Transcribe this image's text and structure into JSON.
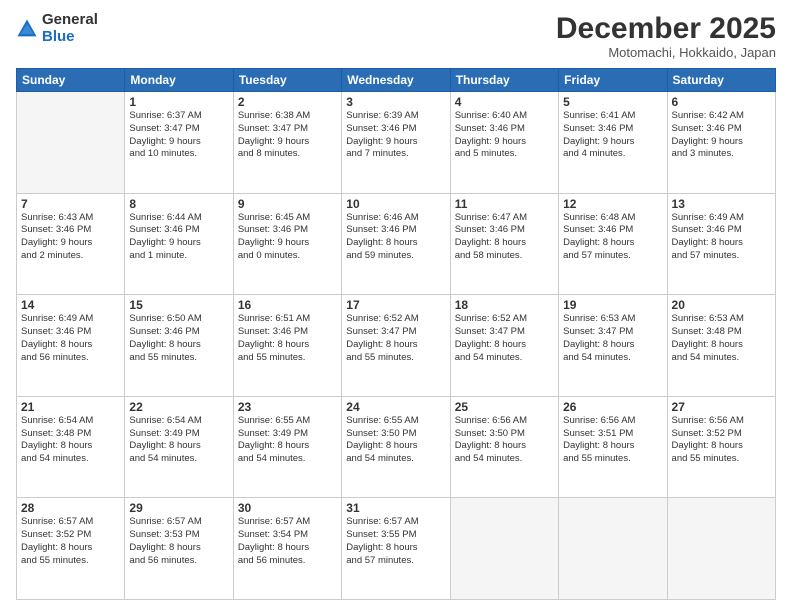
{
  "logo": {
    "general": "General",
    "blue": "Blue"
  },
  "title": "December 2025",
  "subtitle": "Motomachi, Hokkaido, Japan",
  "days_header": [
    "Sunday",
    "Monday",
    "Tuesday",
    "Wednesday",
    "Thursday",
    "Friday",
    "Saturday"
  ],
  "weeks": [
    [
      {
        "day": "",
        "info": ""
      },
      {
        "day": "1",
        "info": "Sunrise: 6:37 AM\nSunset: 3:47 PM\nDaylight: 9 hours\nand 10 minutes."
      },
      {
        "day": "2",
        "info": "Sunrise: 6:38 AM\nSunset: 3:47 PM\nDaylight: 9 hours\nand 8 minutes."
      },
      {
        "day": "3",
        "info": "Sunrise: 6:39 AM\nSunset: 3:46 PM\nDaylight: 9 hours\nand 7 minutes."
      },
      {
        "day": "4",
        "info": "Sunrise: 6:40 AM\nSunset: 3:46 PM\nDaylight: 9 hours\nand 5 minutes."
      },
      {
        "day": "5",
        "info": "Sunrise: 6:41 AM\nSunset: 3:46 PM\nDaylight: 9 hours\nand 4 minutes."
      },
      {
        "day": "6",
        "info": "Sunrise: 6:42 AM\nSunset: 3:46 PM\nDaylight: 9 hours\nand 3 minutes."
      }
    ],
    [
      {
        "day": "7",
        "info": "Sunrise: 6:43 AM\nSunset: 3:46 PM\nDaylight: 9 hours\nand 2 minutes."
      },
      {
        "day": "8",
        "info": "Sunrise: 6:44 AM\nSunset: 3:46 PM\nDaylight: 9 hours\nand 1 minute."
      },
      {
        "day": "9",
        "info": "Sunrise: 6:45 AM\nSunset: 3:46 PM\nDaylight: 9 hours\nand 0 minutes."
      },
      {
        "day": "10",
        "info": "Sunrise: 6:46 AM\nSunset: 3:46 PM\nDaylight: 8 hours\nand 59 minutes."
      },
      {
        "day": "11",
        "info": "Sunrise: 6:47 AM\nSunset: 3:46 PM\nDaylight: 8 hours\nand 58 minutes."
      },
      {
        "day": "12",
        "info": "Sunrise: 6:48 AM\nSunset: 3:46 PM\nDaylight: 8 hours\nand 57 minutes."
      },
      {
        "day": "13",
        "info": "Sunrise: 6:49 AM\nSunset: 3:46 PM\nDaylight: 8 hours\nand 57 minutes."
      }
    ],
    [
      {
        "day": "14",
        "info": "Sunrise: 6:49 AM\nSunset: 3:46 PM\nDaylight: 8 hours\nand 56 minutes."
      },
      {
        "day": "15",
        "info": "Sunrise: 6:50 AM\nSunset: 3:46 PM\nDaylight: 8 hours\nand 55 minutes."
      },
      {
        "day": "16",
        "info": "Sunrise: 6:51 AM\nSunset: 3:46 PM\nDaylight: 8 hours\nand 55 minutes."
      },
      {
        "day": "17",
        "info": "Sunrise: 6:52 AM\nSunset: 3:47 PM\nDaylight: 8 hours\nand 55 minutes."
      },
      {
        "day": "18",
        "info": "Sunrise: 6:52 AM\nSunset: 3:47 PM\nDaylight: 8 hours\nand 54 minutes."
      },
      {
        "day": "19",
        "info": "Sunrise: 6:53 AM\nSunset: 3:47 PM\nDaylight: 8 hours\nand 54 minutes."
      },
      {
        "day": "20",
        "info": "Sunrise: 6:53 AM\nSunset: 3:48 PM\nDaylight: 8 hours\nand 54 minutes."
      }
    ],
    [
      {
        "day": "21",
        "info": "Sunrise: 6:54 AM\nSunset: 3:48 PM\nDaylight: 8 hours\nand 54 minutes."
      },
      {
        "day": "22",
        "info": "Sunrise: 6:54 AM\nSunset: 3:49 PM\nDaylight: 8 hours\nand 54 minutes."
      },
      {
        "day": "23",
        "info": "Sunrise: 6:55 AM\nSunset: 3:49 PM\nDaylight: 8 hours\nand 54 minutes."
      },
      {
        "day": "24",
        "info": "Sunrise: 6:55 AM\nSunset: 3:50 PM\nDaylight: 8 hours\nand 54 minutes."
      },
      {
        "day": "25",
        "info": "Sunrise: 6:56 AM\nSunset: 3:50 PM\nDaylight: 8 hours\nand 54 minutes."
      },
      {
        "day": "26",
        "info": "Sunrise: 6:56 AM\nSunset: 3:51 PM\nDaylight: 8 hours\nand 55 minutes."
      },
      {
        "day": "27",
        "info": "Sunrise: 6:56 AM\nSunset: 3:52 PM\nDaylight: 8 hours\nand 55 minutes."
      }
    ],
    [
      {
        "day": "28",
        "info": "Sunrise: 6:57 AM\nSunset: 3:52 PM\nDaylight: 8 hours\nand 55 minutes."
      },
      {
        "day": "29",
        "info": "Sunrise: 6:57 AM\nSunset: 3:53 PM\nDaylight: 8 hours\nand 56 minutes."
      },
      {
        "day": "30",
        "info": "Sunrise: 6:57 AM\nSunset: 3:54 PM\nDaylight: 8 hours\nand 56 minutes."
      },
      {
        "day": "31",
        "info": "Sunrise: 6:57 AM\nSunset: 3:55 PM\nDaylight: 8 hours\nand 57 minutes."
      },
      {
        "day": "",
        "info": ""
      },
      {
        "day": "",
        "info": ""
      },
      {
        "day": "",
        "info": ""
      }
    ]
  ]
}
